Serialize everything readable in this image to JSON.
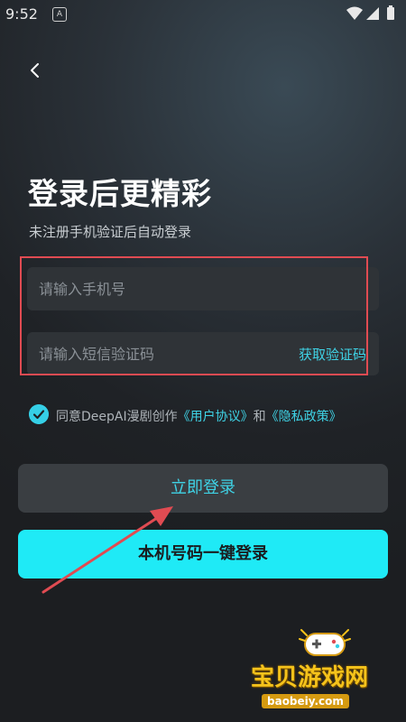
{
  "status_bar": {
    "time": "9:52",
    "notification_icon": "A"
  },
  "header": {
    "back_icon": "chevron-left"
  },
  "title": "登录后更精彩",
  "subtitle": "未注册手机验证后自动登录",
  "form": {
    "phone_placeholder": "请输入手机号",
    "code_placeholder": "请输入短信验证码",
    "get_code_label": "获取验证码"
  },
  "agreement": {
    "checked": true,
    "prefix": "同意DeepAI漫剧创作",
    "user_agreement": "《用户协议》",
    "and": "和",
    "privacy_policy": "《隐私政策》"
  },
  "buttons": {
    "login": "立即登录",
    "one_click": "本机号码一键登录"
  },
  "watermark": {
    "name": "宝贝游戏网",
    "url": "baobeiy.com"
  },
  "colors": {
    "accent": "#3fd3e6",
    "primary_button": "#1feaf6",
    "annotation": "#e04b52"
  }
}
